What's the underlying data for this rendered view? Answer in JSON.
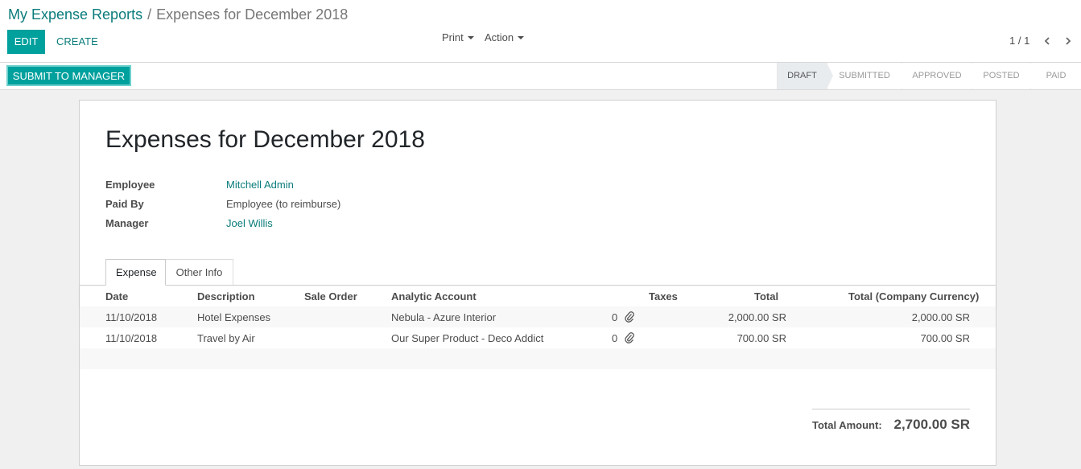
{
  "breadcrumb": {
    "parent": "My Expense Reports",
    "separator": "/",
    "current": "Expenses for December 2018"
  },
  "toolbar": {
    "edit_label": "EDIT",
    "create_label": "CREATE",
    "print_label": "Print",
    "action_label": "Action"
  },
  "pager": {
    "value": "1 / 1"
  },
  "statusbar": {
    "submit_label": "SUBMIT TO MANAGER",
    "stages": [
      {
        "label": "DRAFT",
        "active": true
      },
      {
        "label": "SUBMITTED",
        "active": false
      },
      {
        "label": "APPROVED",
        "active": false
      },
      {
        "label": "POSTED",
        "active": false
      },
      {
        "label": "PAID",
        "active": false
      }
    ]
  },
  "sheet": {
    "title": "Expenses for December 2018",
    "fields": {
      "employee_label": "Employee",
      "employee_value": "Mitchell Admin",
      "paid_by_label": "Paid By",
      "paid_by_value": "Employee (to reimburse)",
      "manager_label": "Manager",
      "manager_value": "Joel Willis"
    },
    "tabs": {
      "expense": "Expense",
      "other_info": "Other Info"
    },
    "table": {
      "headers": {
        "date": "Date",
        "description": "Description",
        "sale_order": "Sale Order",
        "analytic_account": "Analytic Account",
        "taxes": "Taxes",
        "total": "Total",
        "total_company": "Total (Company Currency)"
      },
      "rows": [
        {
          "date": "11/10/2018",
          "description": "Hotel Expenses",
          "analytic_account": "Nebula - Azure Interior",
          "attachments": "0",
          "total": "2,000.00 SR",
          "total_company": "2,000.00 SR"
        },
        {
          "date": "11/10/2018",
          "description": "Travel by Air",
          "analytic_account": "Our Super Product - Deco Addict",
          "attachments": "0",
          "total": "700.00 SR",
          "total_company": "700.00 SR"
        }
      ]
    },
    "total_label": "Total Amount:",
    "total_amount": "2,700.00 SR"
  },
  "colors": {
    "primary": "#00a09d",
    "link": "#0b7b7b"
  }
}
